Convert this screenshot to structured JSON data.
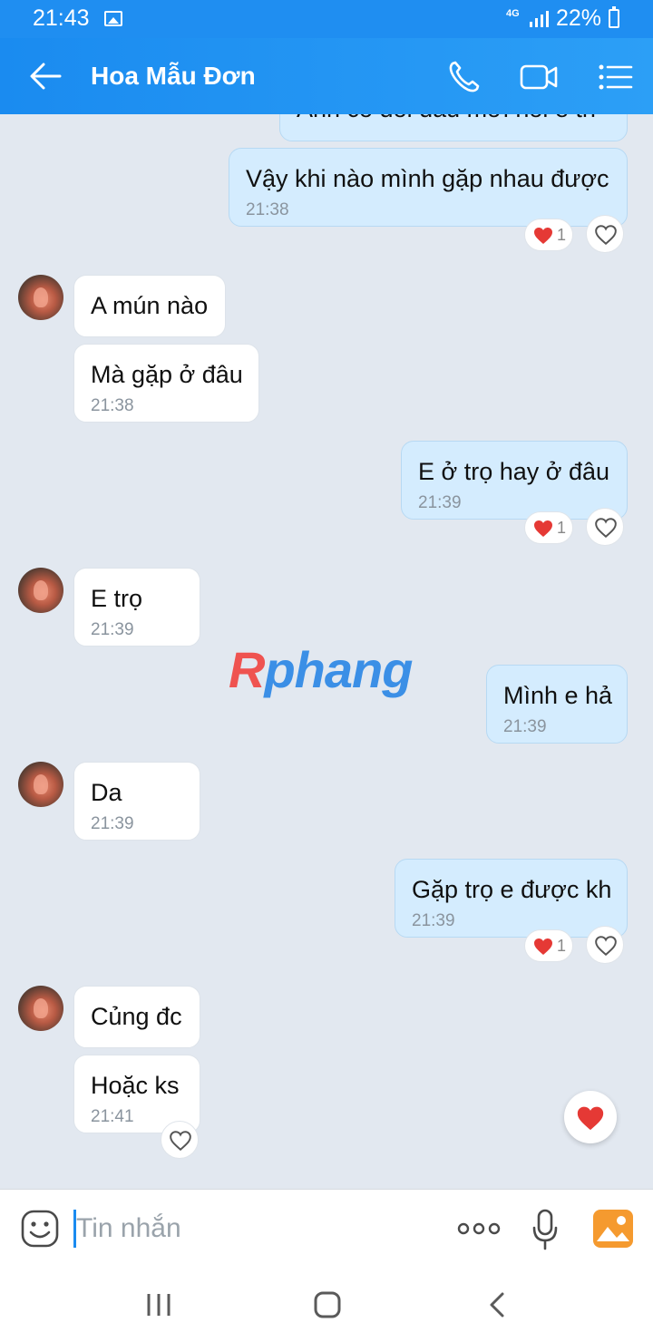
{
  "status_bar": {
    "time": "21:43",
    "network": "4G",
    "battery": "22%"
  },
  "header": {
    "title": "Hoa Mẫu Đơn",
    "accent_color": "#1a8bf0",
    "icons": [
      "back-arrow-icon",
      "phone-icon",
      "video-camera-icon",
      "menu-list-icon"
    ]
  },
  "messages": [
    {
      "from": "me",
      "text": "Anh có đói đâu mới hỏi e th",
      "time": ""
    },
    {
      "from": "me",
      "text": "Vậy khi nào mình gặp nhau được",
      "time": "21:38",
      "reaction_count": "1"
    },
    {
      "from": "them",
      "text": "A mún nào",
      "time": ""
    },
    {
      "from": "them",
      "text": "Mà gặp ở đâu",
      "time": "21:38"
    },
    {
      "from": "me",
      "text": "E ở trọ hay ở đâu",
      "time": "21:39",
      "reaction_count": "1"
    },
    {
      "from": "them",
      "text": "E trọ",
      "time": "21:39"
    },
    {
      "from": "me",
      "text": "Mình e hả",
      "time": "21:39"
    },
    {
      "from": "them",
      "text": "Da",
      "time": "21:39"
    },
    {
      "from": "me",
      "text": "Gặp trọ e được kh",
      "time": "21:39",
      "reaction_count": "1"
    },
    {
      "from": "them",
      "text": "Củng đc",
      "time": ""
    },
    {
      "from": "them",
      "text": "Hoặc ks",
      "time": "21:41"
    }
  ],
  "watermark": {
    "first": "R",
    "rest": "phang"
  },
  "composer": {
    "placeholder": "Tin nhắn",
    "icons": [
      "emoji-icon",
      "more-dots-icon",
      "microphone-icon",
      "gallery-icon"
    ]
  },
  "colors": {
    "my_bubble": "#d4ecfe",
    "their_bubble": "#ffffff",
    "chat_background": "#e2e8f0",
    "heart": "#e53935"
  }
}
